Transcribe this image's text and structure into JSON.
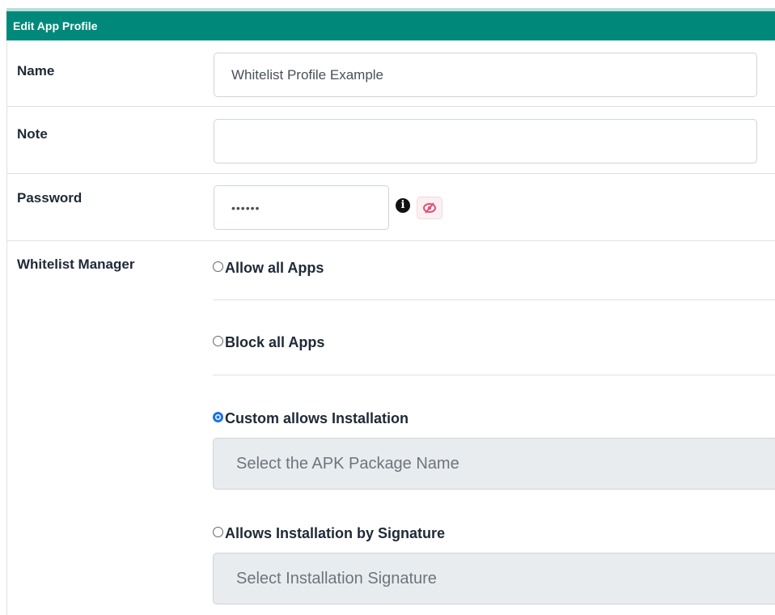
{
  "header": {
    "title": "Edit App Profile"
  },
  "form": {
    "name": {
      "label": "Name",
      "value": "Whitelist Profile Example"
    },
    "note": {
      "label": "Note",
      "value": ""
    },
    "password": {
      "label": "Password",
      "value": "••••••",
      "info_icon": "info-circle-icon",
      "toggle_icon": "eye-slash-icon"
    },
    "whitelist": {
      "label": "Whitelist Manager",
      "options": [
        {
          "label": "Allow all Apps",
          "checked": false
        },
        {
          "label": "Block all Apps",
          "checked": false
        },
        {
          "label": "Custom allows Installation",
          "checked": true
        },
        {
          "label": "Allows Installation by Signature",
          "checked": false
        }
      ],
      "apk_select_placeholder": "Select the APK Package Name",
      "signature_select_placeholder": "Select Installation Signature"
    }
  },
  "colors": {
    "header_bg": "#00897b",
    "radio_checked": "#1a73e8",
    "eye_icon": "#e0507a"
  }
}
